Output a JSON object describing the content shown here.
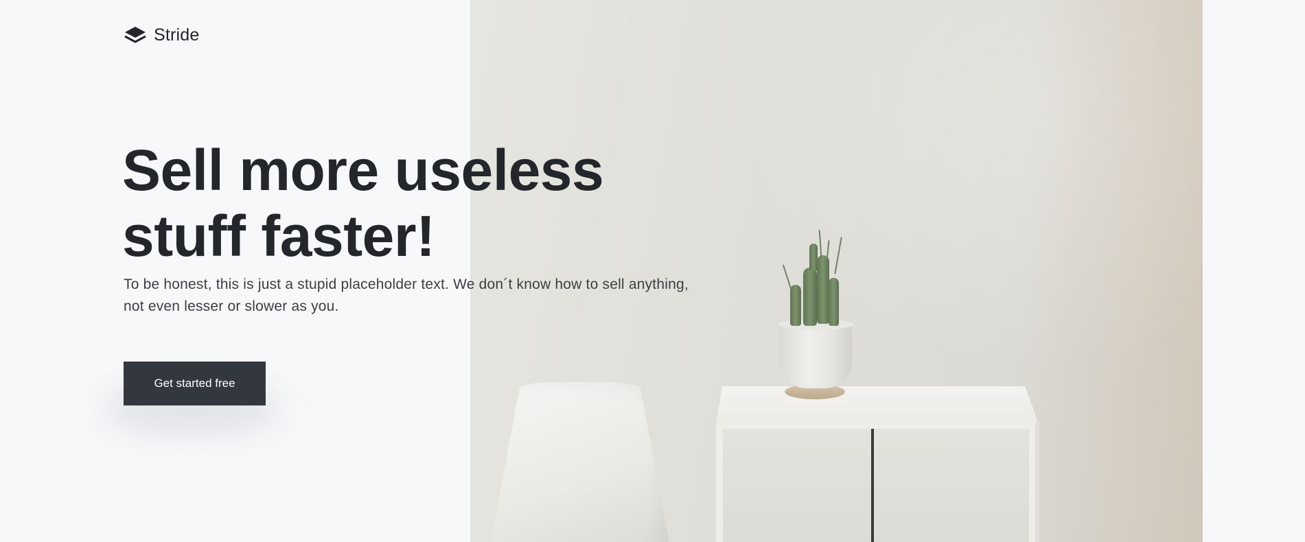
{
  "brand": {
    "name": "Stride",
    "icon": "layers-icon"
  },
  "hero": {
    "headline_line1": "Sell more useless",
    "headline_line2": "stuff faster!",
    "subtext_line1": "To be honest, this is just a stupid placeholder text. We don´t know how to sell anything,",
    "subtext_line2": "not even lesser or slower as you.",
    "cta_label": "Get started free"
  },
  "colors": {
    "background": "#f7f8fa",
    "text": "#23262b",
    "button": "#33373e",
    "button_text": "#ffffff"
  }
}
